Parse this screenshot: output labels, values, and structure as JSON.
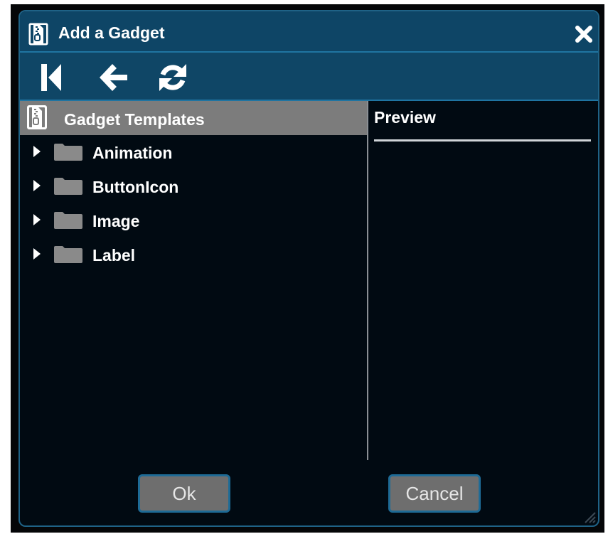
{
  "dialog": {
    "title": "Add a Gadget",
    "title_icon": "gadget-zip-icon",
    "close_icon": "close-icon"
  },
  "toolbar": {
    "buttons": [
      {
        "name": "first-button",
        "icon": "skip-to-start-icon"
      },
      {
        "name": "back-button",
        "icon": "arrow-left-icon"
      },
      {
        "name": "refresh-button",
        "icon": "refresh-icon"
      }
    ]
  },
  "templates": {
    "header": "Gadget Templates",
    "header_icon": "gadget-zip-icon",
    "items": [
      {
        "label": "Animation",
        "icon": "folder-icon"
      },
      {
        "label": "ButtonIcon",
        "icon": "folder-icon"
      },
      {
        "label": "Image",
        "icon": "folder-icon"
      },
      {
        "label": "Label",
        "icon": "folder-icon"
      }
    ]
  },
  "preview": {
    "label": "Preview"
  },
  "footer": {
    "ok_label": "Ok",
    "cancel_label": "Cancel"
  },
  "colors": {
    "titlebar": "#0e4566",
    "accent_border": "#1f74a1",
    "body_bg": "#010a12",
    "header_bg": "#7c7c7c",
    "button_bg": "#6e6e6e"
  }
}
